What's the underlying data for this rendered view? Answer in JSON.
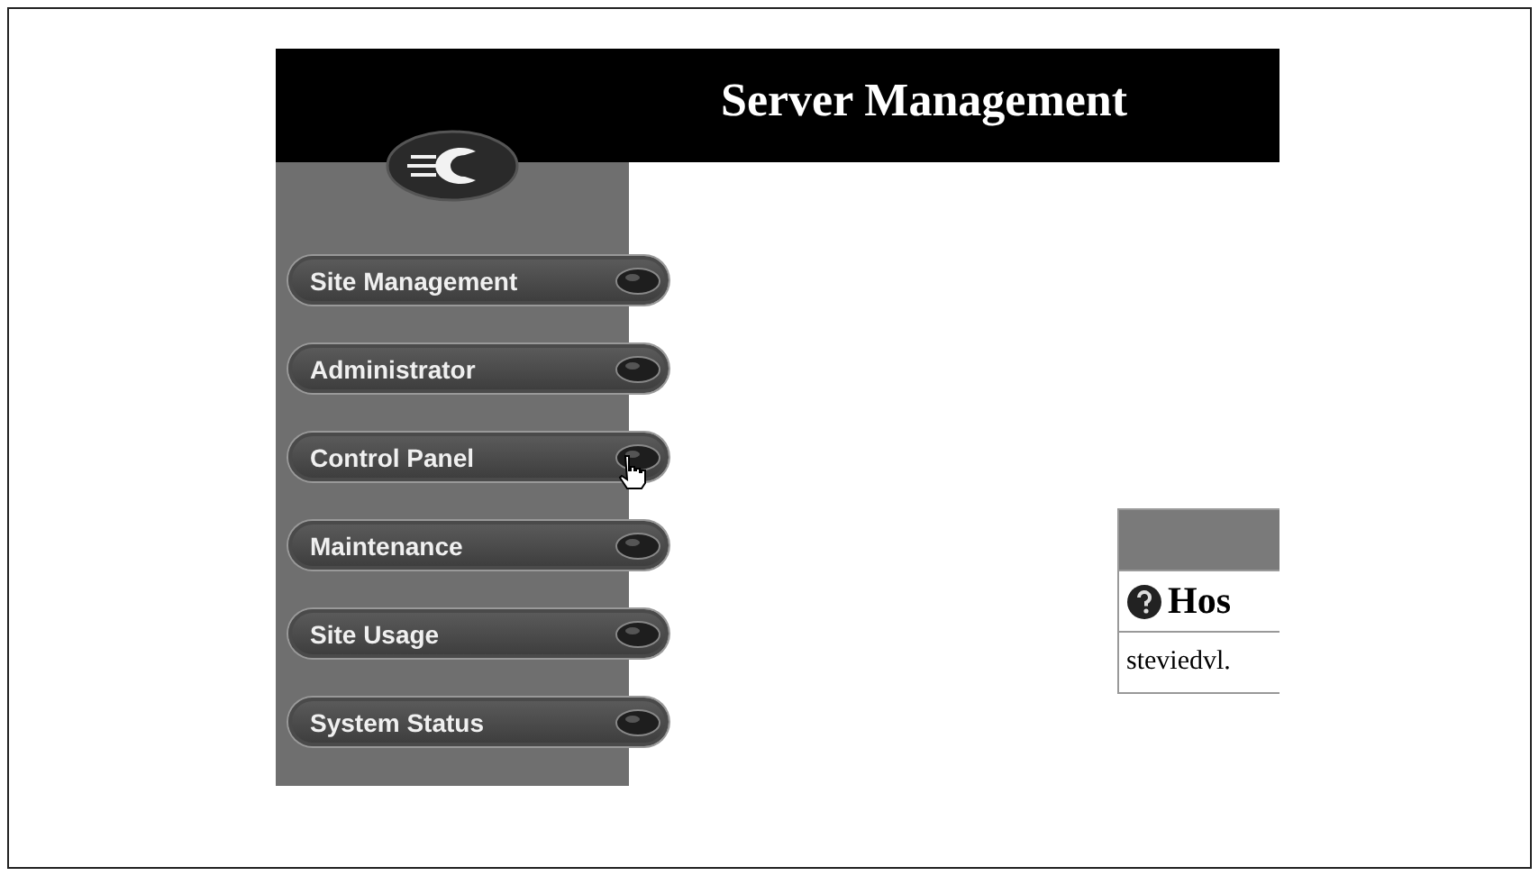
{
  "header": {
    "title": "Server Management"
  },
  "sidebar": {
    "items": [
      {
        "label": "Site Management",
        "hovered": false
      },
      {
        "label": "Administrator",
        "hovered": false
      },
      {
        "label": "Control Panel",
        "hovered": true
      },
      {
        "label": "Maintenance",
        "hovered": false
      },
      {
        "label": "Site Usage",
        "hovered": false
      },
      {
        "label": "System Status",
        "hovered": false
      }
    ]
  },
  "table": {
    "heading": "Hos",
    "rows": [
      "steviedvl."
    ]
  }
}
